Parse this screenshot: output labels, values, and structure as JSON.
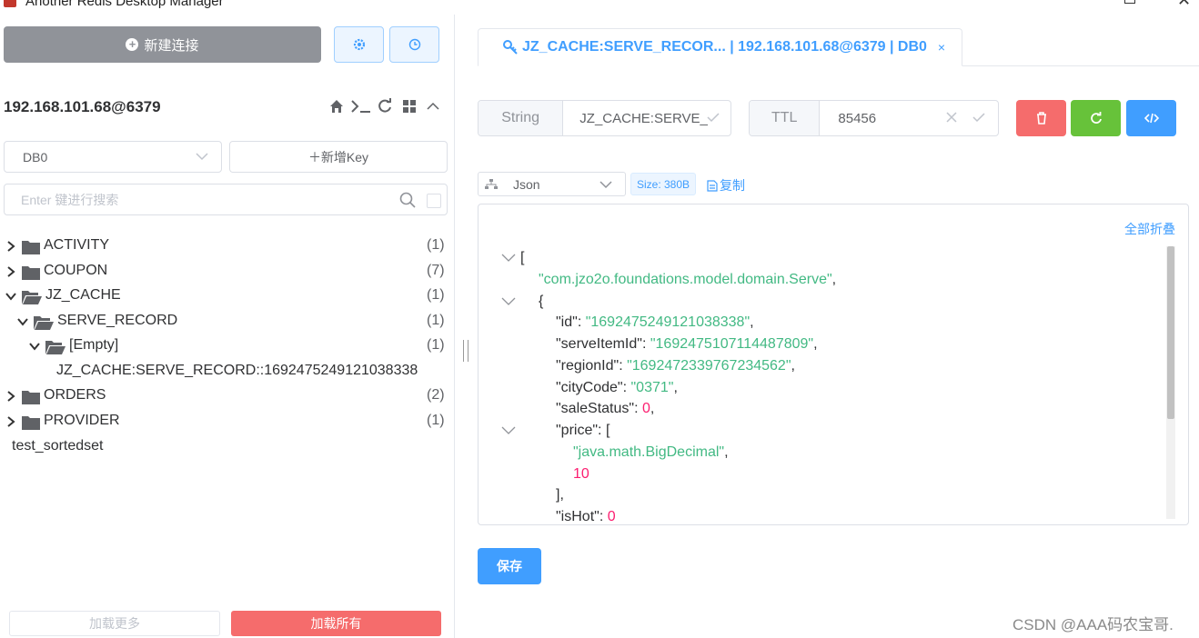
{
  "window": {
    "title": "Another Redis Desktop Manager"
  },
  "sidebar": {
    "new_connection_label": "新建连接",
    "connection_name": "192.168.101.68@6379",
    "db_selected": "DB0",
    "new_key_label": "＋新增Key",
    "search_placeholder": "Enter 键进行搜索",
    "tree": [
      {
        "label": "ACTIVITY",
        "count": "(1)"
      },
      {
        "label": "COUPON",
        "count": "(7)"
      },
      {
        "label": "JZ_CACHE",
        "count": "(1)"
      },
      {
        "label": "SERVE_RECORD",
        "count": "(1)"
      },
      {
        "label": "[Empty]",
        "count": "(1)"
      },
      {
        "label": "JZ_CACHE:SERVE_RECORD::1692475249121038338",
        "count": ""
      },
      {
        "label": "ORDERS",
        "count": "(2)"
      },
      {
        "label": "PROVIDER",
        "count": "(1)"
      },
      {
        "label": "test_sortedset",
        "count": ""
      }
    ],
    "load_more_label": "加载更多",
    "load_all_label": "加载所有"
  },
  "tab": {
    "label": "JZ_CACHE:SERVE_RECOR... | 192.168.101.68@6379 | DB0",
    "close": "×"
  },
  "key_detail": {
    "type": "String",
    "key_name": "JZ_CACHE:SERVE_",
    "ttl_label": "TTL",
    "ttl_value": "85456",
    "format": "Json",
    "size": "Size: 380B",
    "copy_label": "复制",
    "collapse_all_label": "全部折叠",
    "save_label": "保存"
  },
  "json_lines": {
    "l1": "[",
    "l2": "\"com.jzo2o.foundations.model.domain.Serve\"",
    "l2p": ",",
    "l3": "{",
    "l4k": "\"id\"",
    "l4v": "\"1692475249121038338\"",
    "l5k": "\"serveItemId\"",
    "l5v": "\"1692475107114487809\"",
    "l6k": "\"regionId\"",
    "l6v": "\"1692472339767234562\"",
    "l7k": "\"cityCode\"",
    "l7v": "\"0371\"",
    "l8k": "\"saleStatus\"",
    "l8v": "0",
    "l9k": "\"price\"",
    "l9v": "[",
    "l10": "\"java.math.BigDecimal\"",
    "l11": "10",
    "l12": "],",
    "l13k": "\"isHot\"",
    "l13v": "0"
  },
  "watermark": "CSDN @AAA码农宝哥.",
  "colors": {
    "primary": "#409eff",
    "danger": "#f56c6c",
    "success": "#67c23a",
    "json_string": "#42b983",
    "json_number": "#fc1e70"
  }
}
